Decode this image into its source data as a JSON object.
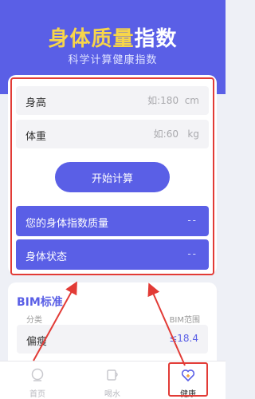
{
  "header": {
    "title_part1": "身体质量",
    "title_part2": "指数",
    "subtitle": "科学计算健康指数"
  },
  "form": {
    "height_label": "身高",
    "height_placeholder": "如:180  cm",
    "weight_label": "体重",
    "weight_placeholder": "如:60   kg",
    "start_button": "开始计算"
  },
  "results": {
    "bmi_quality_label": "您的身体指数质量",
    "bmi_quality_value": "--",
    "status_label": "身体状态",
    "status_value": "--"
  },
  "bmi_standard": {
    "title": "BIM标准",
    "col_category": "分类",
    "col_range": "BIM范围",
    "rows": [
      {
        "category": "偏瘦",
        "range": "≤18.4"
      }
    ]
  },
  "tabbar": {
    "items": [
      {
        "label": "首页",
        "icon": "home-icon"
      },
      {
        "label": "喝水",
        "icon": "water-cup-icon"
      },
      {
        "label": "健康",
        "icon": "health-heart-icon"
      }
    ],
    "active_index": 2
  },
  "colors": {
    "primary": "#5a5fe6",
    "title_yellow": "#f7d54a",
    "annotation_red": "#e23b36"
  }
}
